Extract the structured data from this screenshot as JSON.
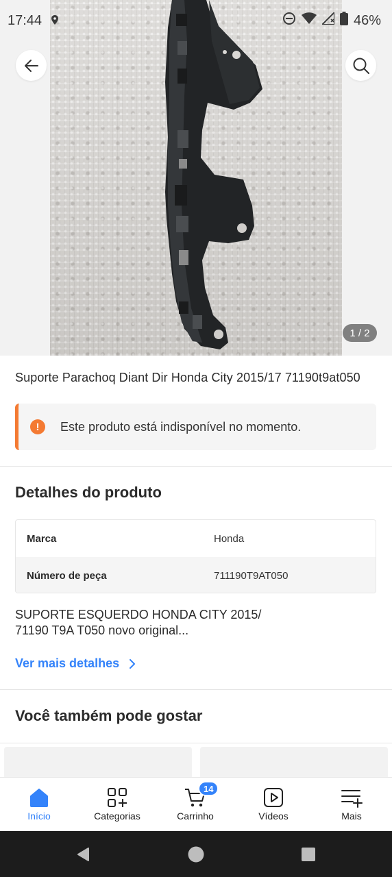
{
  "status_bar": {
    "time": "17:44",
    "battery": "46%",
    "icons": [
      "location-icon",
      "dnd-icon",
      "wifi-icon",
      "signal-icon",
      "battery-icon"
    ]
  },
  "gallery": {
    "counter": "1 / 2"
  },
  "product": {
    "title": "Suporte Parachoq  Diant Dir  Honda City 2015/17 71190t9at050",
    "alert": "Este produto está indisponível no momento.",
    "alert_icon_glyph": "!"
  },
  "details": {
    "title": "Detalhes do produto",
    "specs": [
      {
        "key": "Marca",
        "value": "Honda"
      },
      {
        "key": "Número de peça",
        "value": "711190T9AT050"
      }
    ],
    "description_line1": "SUPORTE ESQUERDO HONDA CITY 2015/",
    "description_line2": "71190 T9A T050 novo original...",
    "more_link": "Ver mais detalhes"
  },
  "recommendations": {
    "title": "Você também pode gostar"
  },
  "bottom_nav": {
    "items": [
      {
        "label": "Início",
        "icon": "home-icon",
        "active": true
      },
      {
        "label": "Categorias",
        "icon": "categories-icon",
        "active": false
      },
      {
        "label": "Carrinho",
        "icon": "cart-icon",
        "active": false,
        "badge": "14"
      },
      {
        "label": "Vídeos",
        "icon": "video-icon",
        "active": false
      },
      {
        "label": "Mais",
        "icon": "menu-icon",
        "active": false
      }
    ]
  },
  "colors": {
    "accent_blue": "#3483fa",
    "alert_orange": "#f47a32",
    "text_dark": "#2b2b2b"
  }
}
